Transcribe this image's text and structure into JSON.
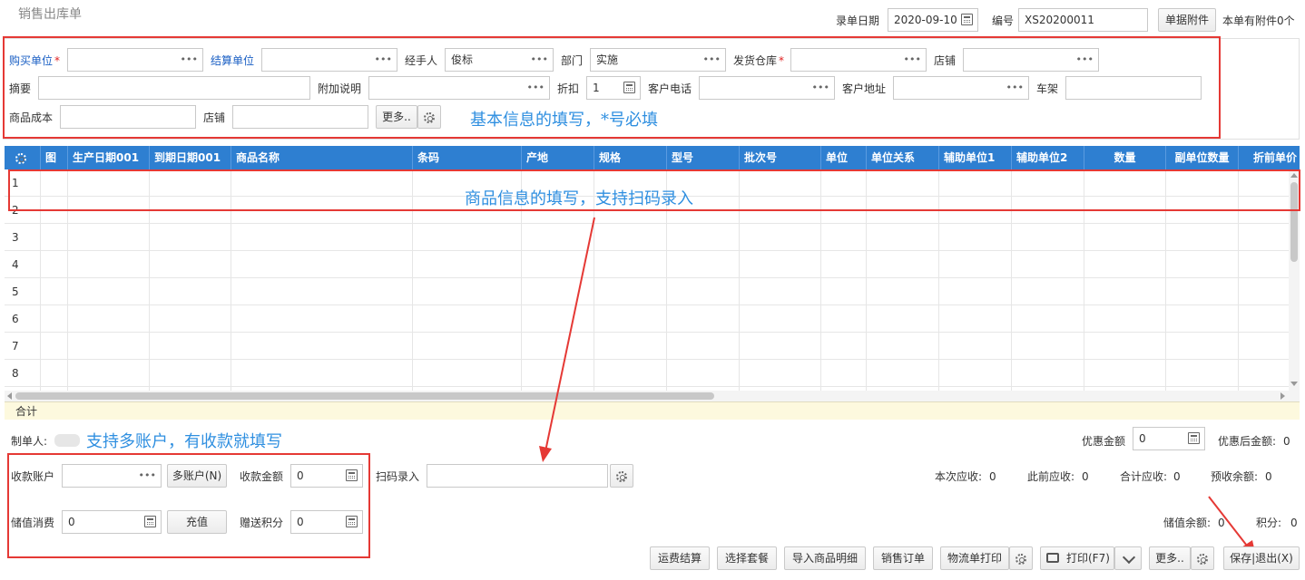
{
  "page": {
    "title": "销售出库单"
  },
  "top": {
    "date_label": "录单日期",
    "date_value": "2020-09-10",
    "number_label": "编号",
    "number_value": "XS20200011",
    "attach_button": "单据附件",
    "attach_info": "本单有附件0个"
  },
  "form": {
    "buyer_label": "购买单位",
    "buyer_value": "",
    "settle_label": "结算单位",
    "settle_value": "",
    "handler_label": "经手人",
    "handler_value": "俊标",
    "dept_label": "部门",
    "dept_value": "实施",
    "warehouse_label": "发货仓库",
    "warehouse_value": "",
    "store_label": "店铺",
    "store_value": "",
    "summary_label": "摘要",
    "summary_value": "",
    "extra_label": "附加说明",
    "extra_value": "",
    "discount_label": "折扣",
    "discount_value": "1",
    "phone_label": "客户电话",
    "phone_value": "",
    "address_label": "客户地址",
    "address_value": "",
    "rack_label": "车架",
    "rack_value": "",
    "cost_label": "商品成本",
    "cost_value": "",
    "store2_label": "店铺",
    "store2_value": "",
    "more_button": "更多..",
    "required_mark": "*"
  },
  "annotations": {
    "basic": "基本信息的填写，*号必填",
    "goods": "商品信息的填写，支持扫码录入",
    "accounts": "支持多账户，有收款就填写"
  },
  "grid": {
    "columns": [
      "图",
      "生产日期001",
      "到期日期001",
      "商品名称",
      "条码",
      "产地",
      "规格",
      "型号",
      "批次号",
      "单位",
      "单位关系",
      "辅助单位1",
      "辅助单位2",
      "数量",
      "副单位数量",
      "折前单价"
    ],
    "rows": [
      "1",
      "2",
      "3",
      "4",
      "5",
      "6",
      "7",
      "8"
    ],
    "summary_label": "合计"
  },
  "bottom": {
    "maker_label": "制单人:",
    "discount_amount_label": "优惠金额",
    "discount_amount_value": "0",
    "after_discount_label": "优惠后金额:",
    "after_discount_value": "0",
    "account_label": "收款账户",
    "account_value": "",
    "multi_account_button": "多账户(N)",
    "receive_amount_label": "收款金额",
    "receive_amount_value": "0",
    "scan_label": "扫码录入",
    "scan_value": "",
    "current_receivable_label": "本次应收:",
    "current_receivable_value": "0",
    "previous_receivable_label": "此前应收:",
    "previous_receivable_value": "0",
    "total_receivable_label": "合计应收:",
    "total_receivable_value": "0",
    "prepaid_label": "预收余额:",
    "prepaid_value": "0",
    "stored_consume_label": "储值消费",
    "stored_consume_value": "0",
    "recharge_button": "充值",
    "gift_points_label": "赠送积分",
    "gift_points_value": "0",
    "stored_balance_label": "储值余额:",
    "stored_balance_value": "0",
    "points_label": "积分:",
    "points_value": "0"
  },
  "actions": {
    "freight": "运费结算",
    "package": "选择套餐",
    "import": "导入商品明细",
    "order": "销售订单",
    "logistics": "物流单打印",
    "print": "打印(F7)",
    "more": "更多..",
    "save_exit": "保存|退出(X)"
  },
  "colors": {
    "header": "#2e7fd1",
    "annotation": "#2f8fe0",
    "highlight": "#e53935",
    "required": "#e02020"
  }
}
